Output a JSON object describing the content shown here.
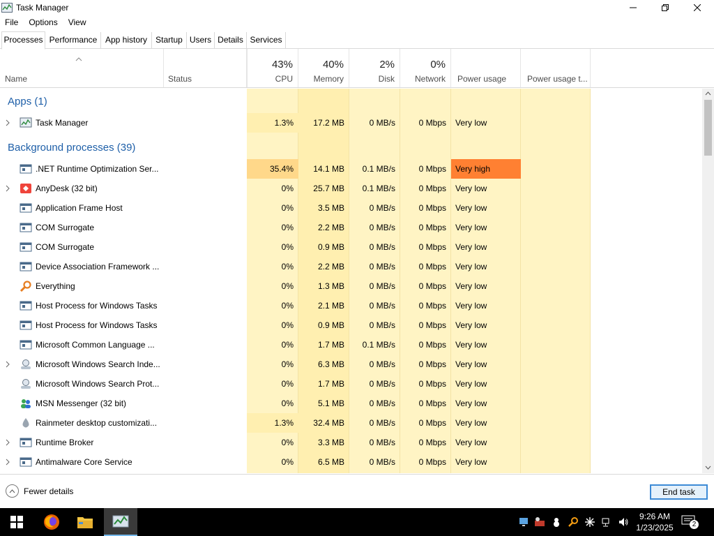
{
  "window": {
    "title": "Task Manager"
  },
  "menu": [
    "File",
    "Options",
    "View"
  ],
  "tabs": [
    "Processes",
    "Performance",
    "App history",
    "Startup",
    "Users",
    "Details",
    "Services"
  ],
  "header": {
    "name": "Name",
    "status": "Status",
    "cpu": {
      "pct": "43%",
      "label": "CPU"
    },
    "memory": {
      "pct": "40%",
      "label": "Memory"
    },
    "disk": {
      "pct": "2%",
      "label": "Disk"
    },
    "network": {
      "pct": "0%",
      "label": "Network"
    },
    "power": "Power usage",
    "power_trend": "Power usage t..."
  },
  "groups": {
    "apps": "Apps (1)",
    "background": "Background processes (39)"
  },
  "rows": [
    {
      "name": "Task Manager",
      "cpu": "1.3%",
      "mem": "17.2 MB",
      "disk": "0 MB/s",
      "net": "0 Mbps",
      "power": "Very low",
      "icon": "task-manager-icon"
    },
    {
      "name": ".NET Runtime Optimization Ser...",
      "cpu": "35.4%",
      "mem": "14.1 MB",
      "disk": "0.1 MB/s",
      "net": "0 Mbps",
      "power": "Very high",
      "icon": "service-window-icon"
    },
    {
      "name": "AnyDesk (32 bit)",
      "cpu": "0%",
      "mem": "25.7 MB",
      "disk": "0.1 MB/s",
      "net": "0 Mbps",
      "power": "Very low",
      "icon": "anydesk-icon"
    },
    {
      "name": "Application Frame Host",
      "cpu": "0%",
      "mem": "3.5 MB",
      "disk": "0 MB/s",
      "net": "0 Mbps",
      "power": "Very low",
      "icon": "service-window-icon"
    },
    {
      "name": "COM Surrogate",
      "cpu": "0%",
      "mem": "2.2 MB",
      "disk": "0 MB/s",
      "net": "0 Mbps",
      "power": "Very low",
      "icon": "service-window-icon"
    },
    {
      "name": "COM Surrogate",
      "cpu": "0%",
      "mem": "0.9 MB",
      "disk": "0 MB/s",
      "net": "0 Mbps",
      "power": "Very low",
      "icon": "service-window-icon"
    },
    {
      "name": "Device Association Framework ...",
      "cpu": "0%",
      "mem": "2.2 MB",
      "disk": "0 MB/s",
      "net": "0 Mbps",
      "power": "Very low",
      "icon": "service-window-icon"
    },
    {
      "name": "Everything",
      "cpu": "0%",
      "mem": "1.3 MB",
      "disk": "0 MB/s",
      "net": "0 Mbps",
      "power": "Very low",
      "icon": "everything-search-icon"
    },
    {
      "name": "Host Process for Windows Tasks",
      "cpu": "0%",
      "mem": "2.1 MB",
      "disk": "0 MB/s",
      "net": "0 Mbps",
      "power": "Very low",
      "icon": "service-window-icon"
    },
    {
      "name": "Host Process for Windows Tasks",
      "cpu": "0%",
      "mem": "0.9 MB",
      "disk": "0 MB/s",
      "net": "0 Mbps",
      "power": "Very low",
      "icon": "service-window-icon"
    },
    {
      "name": "Microsoft Common Language ...",
      "cpu": "0%",
      "mem": "1.7 MB",
      "disk": "0.1 MB/s",
      "net": "0 Mbps",
      "power": "Very low",
      "icon": "service-window-icon"
    },
    {
      "name": "Microsoft Windows Search Inde...",
      "cpu": "0%",
      "mem": "6.3 MB",
      "disk": "0 MB/s",
      "net": "0 Mbps",
      "power": "Very low",
      "icon": "search-indexer-icon"
    },
    {
      "name": "Microsoft Windows Search Prot...",
      "cpu": "0%",
      "mem": "1.7 MB",
      "disk": "0 MB/s",
      "net": "0 Mbps",
      "power": "Very low",
      "icon": "search-indexer-icon"
    },
    {
      "name": "MSN Messenger (32 bit)",
      "cpu": "0%",
      "mem": "5.1 MB",
      "disk": "0 MB/s",
      "net": "0 Mbps",
      "power": "Very low",
      "icon": "msn-messenger-icon"
    },
    {
      "name": "Rainmeter desktop customizati...",
      "cpu": "1.3%",
      "mem": "32.4 MB",
      "disk": "0 MB/s",
      "net": "0 Mbps",
      "power": "Very low",
      "icon": "rainmeter-icon"
    },
    {
      "name": "Runtime Broker",
      "cpu": "0%",
      "mem": "3.3 MB",
      "disk": "0 MB/s",
      "net": "0 Mbps",
      "power": "Very low",
      "icon": "service-window-icon"
    },
    {
      "name": "Antimalware Core Service",
      "cpu": "0%",
      "mem": "6.5 MB",
      "disk": "0 MB/s",
      "net": "0 Mbps",
      "power": "Very low",
      "icon": "service-window-icon"
    }
  ],
  "footer": {
    "fewer": "Fewer details",
    "end_task": "End task"
  },
  "clock": {
    "time": "9:26 AM",
    "date": "1/23/2025"
  },
  "notifications": "2",
  "colors": {
    "group": "#1e5fa8",
    "heat_light": "#fff4c4",
    "heat_mid": "#ffe9a2",
    "heat_high": "#ff8032"
  }
}
